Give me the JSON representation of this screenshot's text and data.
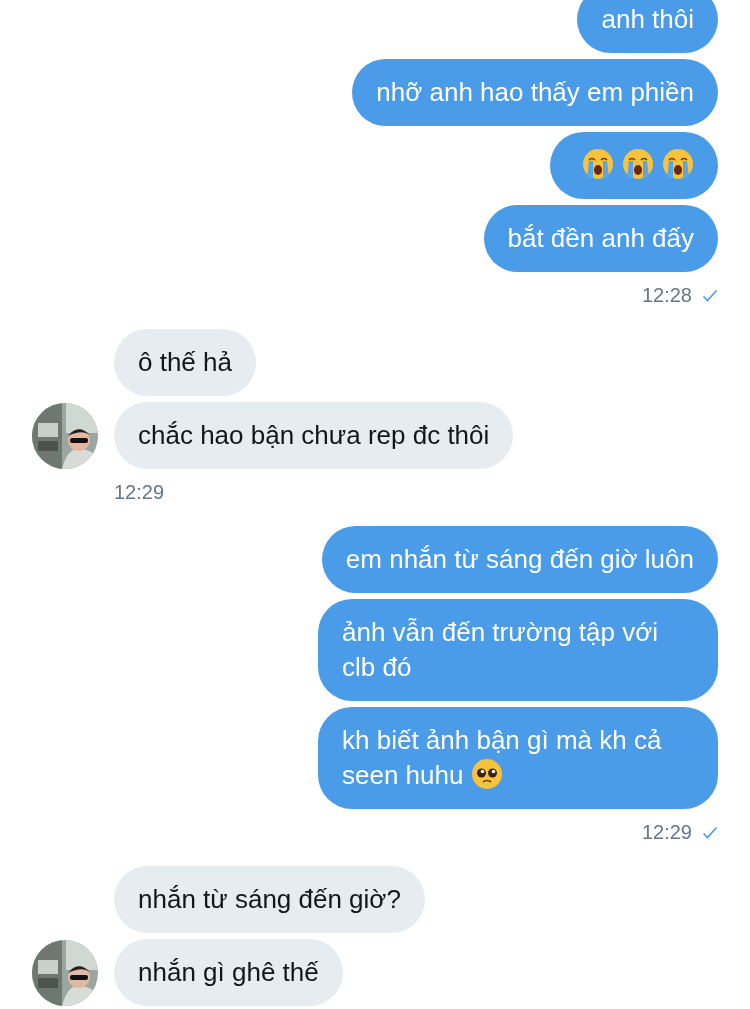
{
  "groups": [
    {
      "outgoing": true,
      "messages": [
        {
          "text": "anh thôi"
        },
        {
          "text": "nhỡ anh hao thấy em phiền"
        },
        {
          "emojis": [
            {
              "kind": "crying"
            },
            {
              "kind": "crying"
            },
            {
              "kind": "crying"
            }
          ]
        },
        {
          "text": "bắt đền anh đấy"
        }
      ],
      "time": "12:28",
      "read": true
    },
    {
      "outgoing": false,
      "messages": [
        {
          "text": "ô thế hả"
        },
        {
          "text": "chắc hao bận chưa rep đc thôi"
        }
      ],
      "time": "12:29"
    },
    {
      "outgoing": true,
      "messages": [
        {
          "text": "em nhắn từ sáng đến giờ luôn"
        },
        {
          "text": "ảnh vẫn đến trường tập với clb đó"
        },
        {
          "text": "kh biết ảnh bận gì mà kh cả seen huhu",
          "emojis": [
            {
              "kind": "pleading"
            }
          ]
        }
      ],
      "time": "12:29",
      "read": true
    },
    {
      "outgoing": false,
      "messages": [
        {
          "text": "nhắn từ sáng đến giờ?"
        },
        {
          "text": "nhắn gì ghê thế"
        }
      ]
    }
  ]
}
